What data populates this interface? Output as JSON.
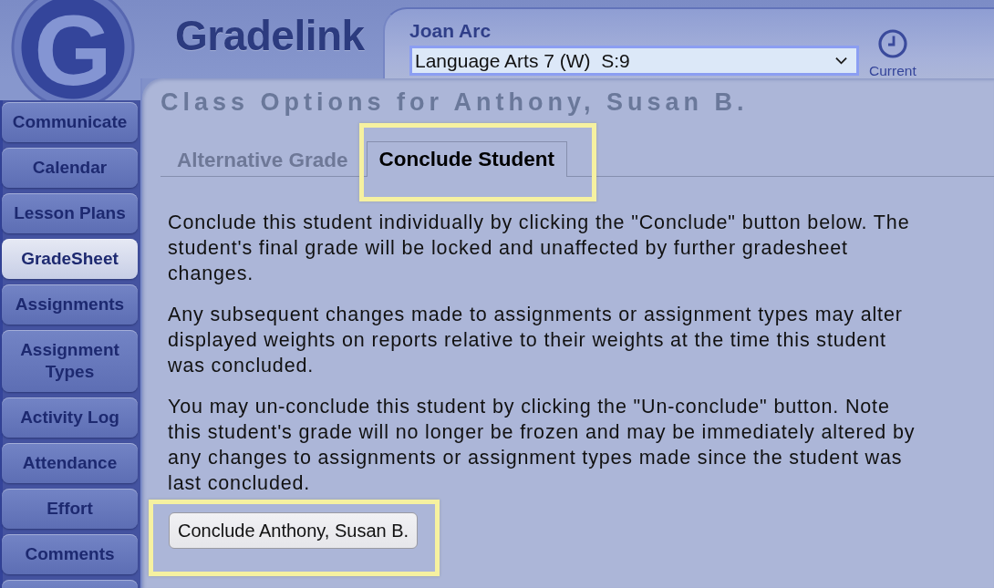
{
  "header": {
    "logo_letter": "G",
    "brand": "Gradelink",
    "user_name": "Joan Arc",
    "class_select": {
      "value": "Language Arts 7 (W)  S:9"
    },
    "term_button": {
      "label": "Current"
    }
  },
  "sidebar": {
    "items": [
      {
        "kind": "button",
        "label": "Communicate",
        "selected": false
      },
      {
        "kind": "button",
        "label": "Calendar",
        "selected": false
      },
      {
        "kind": "button",
        "label": "Lesson Plans",
        "selected": false
      },
      {
        "kind": "button",
        "label": "GradeSheet",
        "selected": true
      },
      {
        "kind": "button",
        "label": "Assignments",
        "selected": false
      },
      {
        "kind": "button",
        "label": "Assignment Types",
        "selected": false
      },
      {
        "kind": "button",
        "label": "Activity Log",
        "selected": false
      },
      {
        "kind": "button",
        "label": "Attendance",
        "selected": false
      },
      {
        "kind": "button",
        "label": "Effort",
        "selected": false
      },
      {
        "kind": "button",
        "label": "Comments",
        "selected": false
      },
      {
        "kind": "partial",
        "selected": false
      }
    ]
  },
  "main": {
    "title": "Class Options for Anthony, Susan B.",
    "tabs": [
      {
        "label": "Alternative Grade",
        "selected": false,
        "highlighted": false
      },
      {
        "label": "Conclude Student",
        "selected": true,
        "highlighted": true
      }
    ],
    "paragraphs": [
      "Conclude this student individually by clicking the \"Conclude\" button below. The student's final grade will be locked and unaffected by further gradesheet changes.",
      "Any subsequent changes made to assignments or assignment types may alter displayed weights on reports relative to their weights at the time this student was concluded.",
      "You may un-conclude this student by clicking the \"Un-conclude\" button. Note this student's grade will no longer be frozen and may be immediately altered by any changes to assignments or assignment types made since the student was last concluded."
    ],
    "action_button": {
      "label": "Conclude Anthony, Susan B.",
      "highlighted": true
    }
  }
}
